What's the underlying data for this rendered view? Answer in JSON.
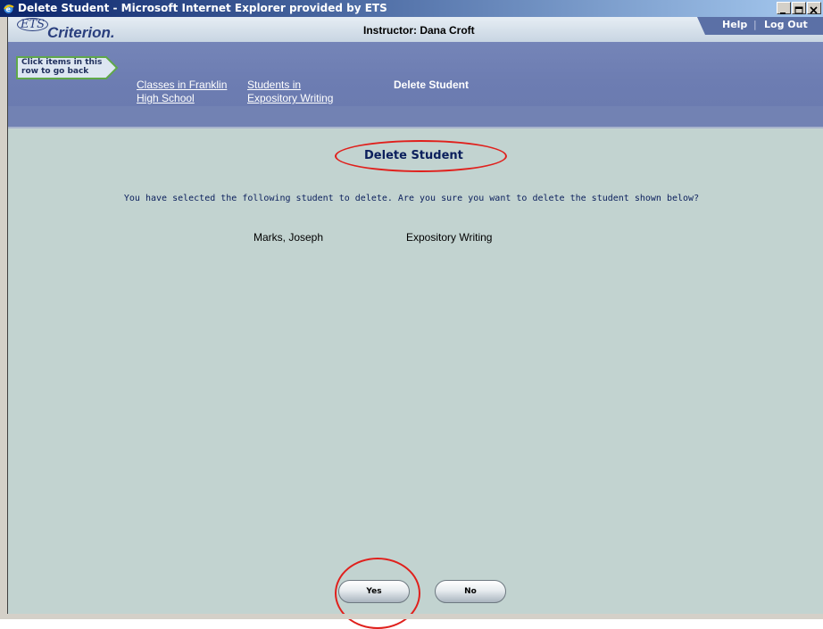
{
  "window": {
    "title": "Delete Student - Microsoft Internet Explorer provided by ETS",
    "controls": [
      "minimize",
      "maximize",
      "close"
    ]
  },
  "header": {
    "logo_mark": "ETS",
    "logo_text": "Criterion.",
    "instructor": "Instructor: Dana Croft",
    "help": "Help",
    "separator": "|",
    "logout": "Log Out"
  },
  "breadcrumb": {
    "hint": "Click items in this\nrow to go back",
    "items": [
      {
        "line1": "Classes in Franklin",
        "line2": "High School"
      },
      {
        "line1": "Students in",
        "line2": "Expository Writing"
      }
    ],
    "current": "Delete Student"
  },
  "main": {
    "title": "Delete Student",
    "prompt": "You have selected the following student to delete. Are you sure you want to delete the student shown below?",
    "student": {
      "name": "Marks, Joseph",
      "class": "Expository Writing"
    }
  },
  "buttons": {
    "yes": "Yes",
    "no": "No"
  },
  "annotations": {
    "highlight_color": "#e0201c"
  }
}
